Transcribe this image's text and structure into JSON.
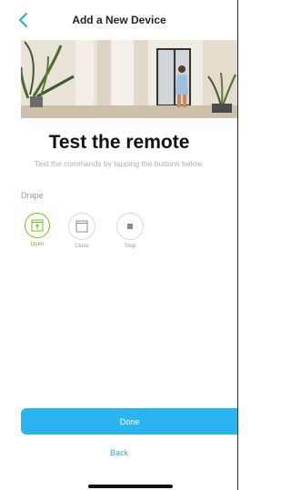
{
  "header": {
    "title": "Add a New Device",
    "back_icon": "chevron-left-icon"
  },
  "hero": {
    "image": "living-room-curtains-photo"
  },
  "main": {
    "headline": "Test the remote",
    "subtitle": "Test the commands by tapping the buttons below.",
    "section_label": "Drape"
  },
  "controls": [
    {
      "label": "Open",
      "icon": "curtain-open-icon",
      "active": true
    },
    {
      "label": "Close",
      "icon": "curtain-close-icon",
      "active": false
    },
    {
      "label": "Stop",
      "icon": "stop-icon",
      "active": false
    }
  ],
  "footer": {
    "done_label": "Done",
    "back_label": "Back"
  },
  "colors": {
    "accent_blue": "#2ab5f0",
    "link_blue": "#2aa9e0",
    "active_green": "#6fc12b",
    "muted_text": "#9a9a9a"
  }
}
